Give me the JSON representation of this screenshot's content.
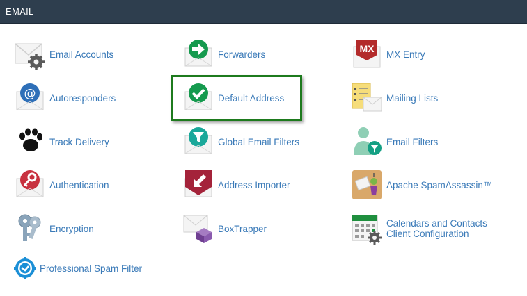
{
  "header": {
    "title": "EMAIL"
  },
  "items": {
    "email_accounts": "Email Accounts",
    "forwarders": "Forwarders",
    "mx_entry": "MX Entry",
    "autoresponders": "Autoresponders",
    "default_address": "Default Address",
    "mailing_lists": "Mailing Lists",
    "track_delivery": "Track Delivery",
    "global_email_filters": "Global Email Filters",
    "email_filters": "Email Filters",
    "authentication": "Authentication",
    "address_importer": "Address Importer",
    "apache_spamassassin": "Apache SpamAssassin™",
    "encryption": "Encryption",
    "boxtrapper": "BoxTrapper",
    "calendars_line1": "Calendars and Contacts",
    "calendars_line2": "Client Configuration",
    "professional_spam_filter": "Professional Spam Filter"
  },
  "icons": {
    "email_accounts": "envelope-gear-icon",
    "forwarders": "forward-arrow-icon",
    "mx_entry": "mx-envelope-icon",
    "autoresponders": "at-sign-icon",
    "default_address": "checkmark-envelope-icon",
    "mailing_lists": "list-envelope-icon",
    "track_delivery": "paw-print-icon",
    "global_email_filters": "funnel-envelope-icon",
    "email_filters": "user-filter-icon",
    "authentication": "key-envelope-icon",
    "address_importer": "import-arrow-icon",
    "apache_spamassassin": "spamassassin-icon",
    "encryption": "keys-icon",
    "boxtrapper": "box-envelope-icon",
    "calendars": "calendar-gear-icon",
    "professional_spam_filter": "spam-shield-icon"
  },
  "colors": {
    "header_bg": "#2e3e4e",
    "link": "#3a7ab8",
    "highlight_border": "#1d7a1d"
  }
}
